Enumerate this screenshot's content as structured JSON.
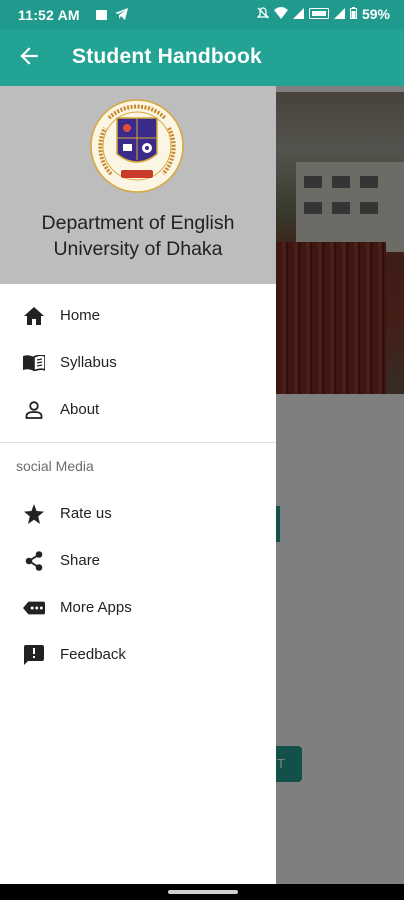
{
  "status_bar": {
    "time": "11:52 AM",
    "battery": "59%",
    "icons": [
      "image-icon",
      "telegram-icon",
      "mute-icon",
      "wifi-icon",
      "signal-icon",
      "volte-icon",
      "signal-icon",
      "battery-icon"
    ]
  },
  "app_bar": {
    "title": "Student Handbook",
    "back_icon": "arrow-back-icon",
    "color": "#22a393"
  },
  "drawer": {
    "header": {
      "line1": "Department of English",
      "line2": "University of Dhaka",
      "logo": "university-of-dhaka-seal"
    },
    "primary_items": [
      {
        "label": "Home",
        "icon": "home-icon"
      },
      {
        "label": "Syllabus",
        "icon": "book-icon"
      },
      {
        "label": "About",
        "icon": "person-icon"
      }
    ],
    "section_title": "social Media",
    "social_items": [
      {
        "label": "Rate us",
        "icon": "star-icon"
      },
      {
        "label": "Share",
        "icon": "share-icon"
      },
      {
        "label": "More Apps",
        "icon": "more-apps-icon"
      },
      {
        "label": "Feedback",
        "icon": "feedback-icon"
      }
    ]
  },
  "background_content": {
    "button_fragment": "T"
  }
}
